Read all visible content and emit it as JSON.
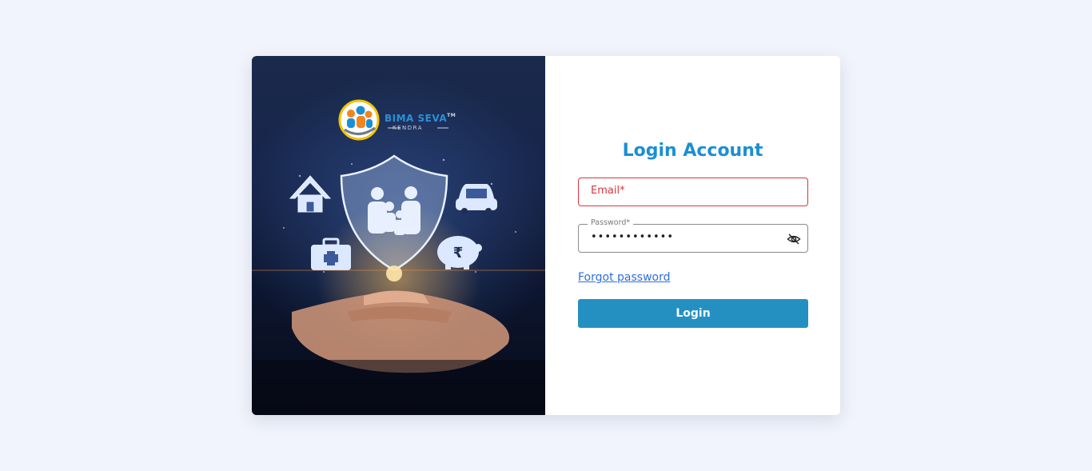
{
  "brand": {
    "name": "Bima Seva",
    "name_display": "BIMA SEVA",
    "trademark": "TM",
    "sub": "KENDRA"
  },
  "login": {
    "title": "Login Account",
    "email_placeholder": "Email*",
    "password_label": "Password*",
    "password_value": "••••••••••••",
    "forgot_label": "Forgot password",
    "login_label": "Login"
  },
  "icons": {
    "hero": [
      "house-icon",
      "car-icon",
      "medical-kit-icon",
      "piggy-bank-rupee-icon",
      "family-shield-icon",
      "hands"
    ],
    "password_toggle": "eye-off-icon"
  },
  "colors": {
    "background": "#f1f4fc",
    "title": "#1b8fd3",
    "error": "#d9363e",
    "button": "#2490c2",
    "link": "#2f6fd8"
  }
}
